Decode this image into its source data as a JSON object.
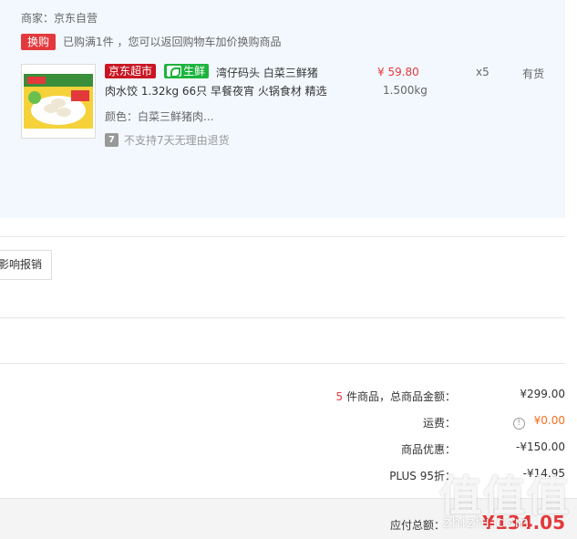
{
  "merchant": {
    "label": "商家：京东自营"
  },
  "promo": {
    "tag": "换购",
    "text": "已购满1件 ，您可以返回购物车加价换购商品"
  },
  "item": {
    "badge_store": "京东超市",
    "badge_fresh": "生鲜",
    "title": "湾仔码头 白菜三鲜猪肉水饺 1.32kg 66只 早餐夜宵 火锅食材 精选",
    "price": "¥ 59.80",
    "weight": "1.500kg",
    "quantity": "x5",
    "stock": "有货",
    "color": "颜色：白菜三鲜猪肉...",
    "return_icon": "7",
    "return_policy": "不支持7天无理由退货",
    "thumb_icon": "dumpling-package-image"
  },
  "invoice": {
    "button_label": "影响报销"
  },
  "summary": {
    "count": "5",
    "count_label": " 件商品，总商品金额：",
    "goods_total": "¥299.00",
    "shipping_label": "运费：",
    "shipping_value": "¥0.00",
    "discount_label": "商品优惠：",
    "discount_value": "-¥150.00",
    "plus_label": "PLUS 95折：",
    "plus_value": "-¥14.95",
    "payable_label": "应付总额：",
    "payable_value": "¥134.05"
  },
  "watermark": {
    "chars": "值值值",
    "url": "zhizhi.com"
  },
  "colors": {
    "accent_red": "#e4393c",
    "fresh_green": "#1cb43d",
    "orange": "#f56d1e",
    "panel_bg": "#f3f8fe"
  }
}
